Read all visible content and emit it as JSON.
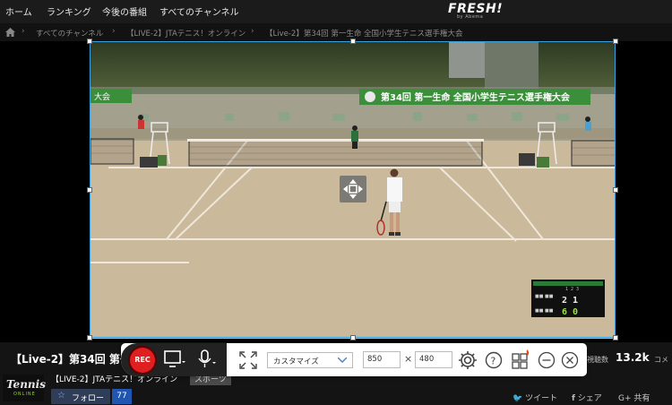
{
  "nav": {
    "items": [
      "ホーム",
      "ランキング",
      "今後の番組",
      "すべてのチャンネル"
    ],
    "logo": "FRESH!",
    "logo_sub": "by Abema"
  },
  "breadcrumb": [
    "すべてのチャンネル",
    "【LIVE-2】JTAテニス！オンライン",
    "【Live-2】第34回 第一生命 全国小学生テニス選手権大会"
  ],
  "video": {
    "banner_text": "第34回 第一生命 全国小学生テニス選手権大会",
    "banner_left_text": "大会",
    "score": {
      "set_header": [
        "1",
        "2",
        "3"
      ],
      "player1_score": "2 1",
      "player2_score": "6 0"
    }
  },
  "program": {
    "title": "【Live-2】第34回 第一",
    "views_label": "視聴数",
    "views": "13.2k",
    "comments_label": "コメ",
    "channel_name": "【LIVE-2】JTAテニス！オンライン",
    "category": "スポーツ",
    "channel_logo": "Tennis",
    "channel_logo_sub": "ONLINE",
    "follow_label": "フォロー",
    "follow_count": "77",
    "share_tweet": "ツイート",
    "share_facebook": "シェア",
    "share_gplus": "G+ 共有"
  },
  "recorder": {
    "rec_label": "REC",
    "preset": "カスタマイズ",
    "width": "850",
    "height": "480",
    "times": "×",
    "icons": [
      "screen-icon",
      "microphone-icon",
      "fullscreen-icon",
      "settings-icon",
      "help-icon",
      "apps-icon",
      "minimize-icon",
      "close-icon"
    ]
  }
}
